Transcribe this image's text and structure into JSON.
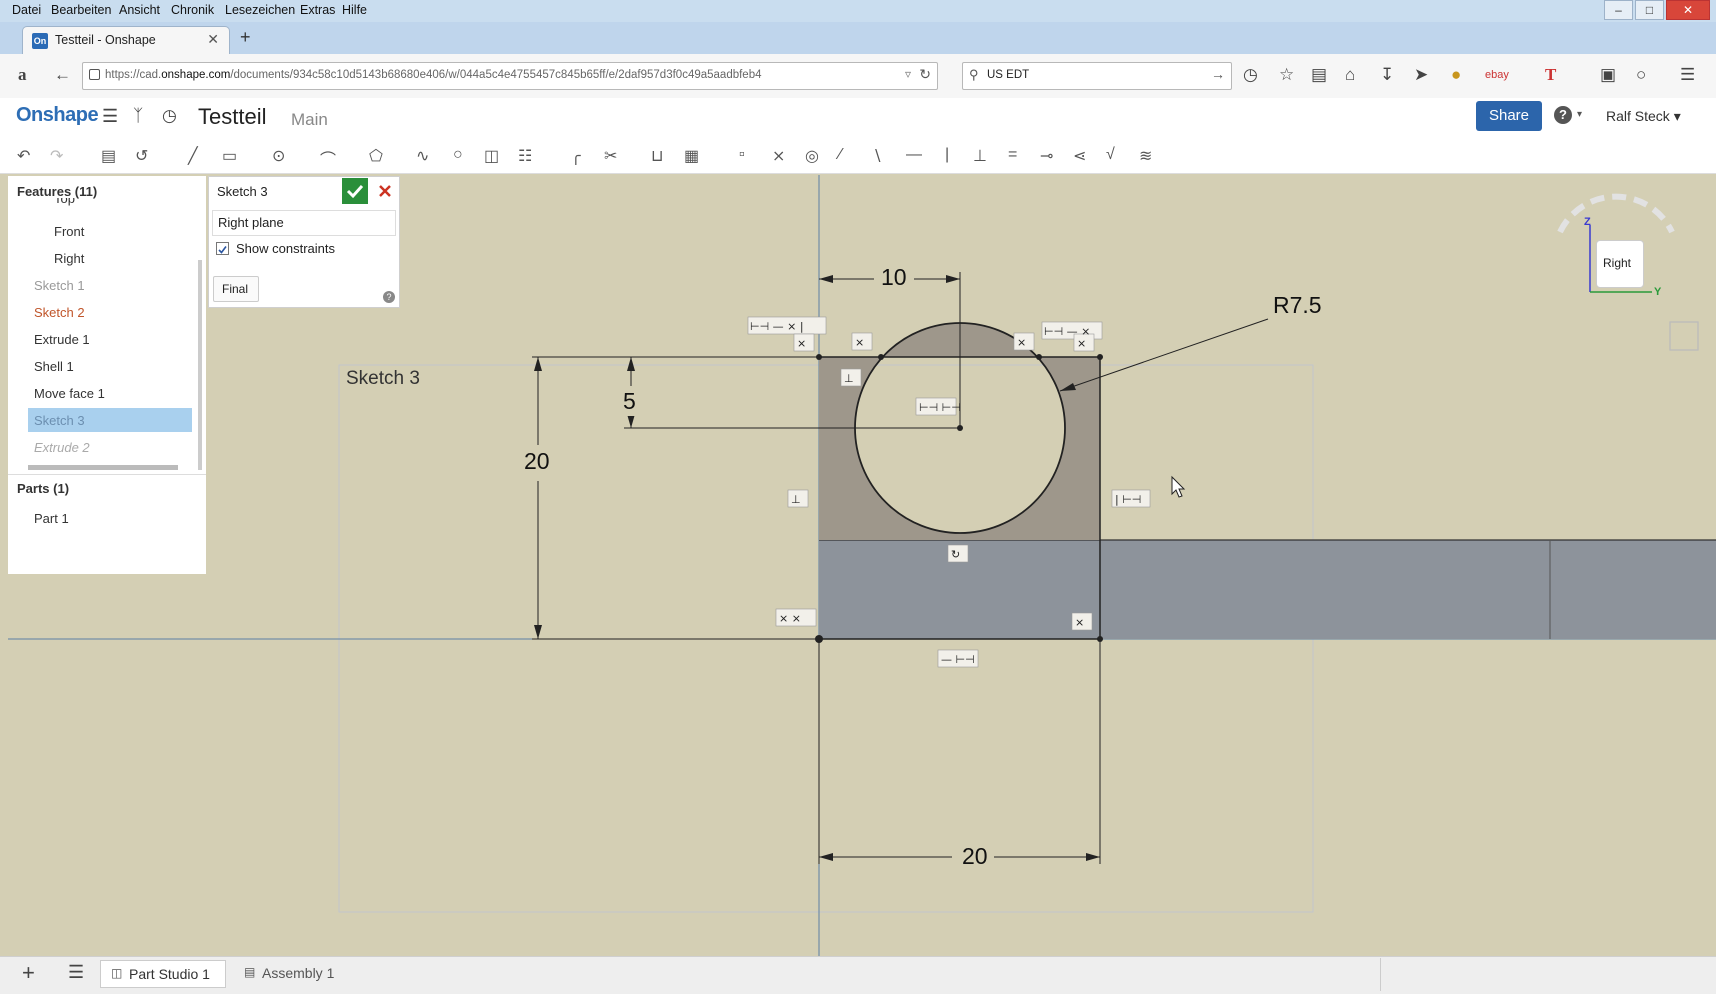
{
  "browser": {
    "menu": [
      "Datei",
      "Bearbeiten",
      "Ansicht",
      "Chronik",
      "Lesezeichen",
      "Extras",
      "Hilfe"
    ],
    "tab_title": "Testteil - Onshape",
    "tab_favicon": "On",
    "url_prefix": "https://cad.",
    "url_host": "onshape.com",
    "url_path": "/documents/934c58c10d5143b68680e406/w/044a5c4e4755457c845b65ff/e/2daf957d3f0c49a5aadbfeb4",
    "search_value": "US EDT"
  },
  "header": {
    "logo": "Onshape",
    "doc_title": "Testteil",
    "workspace": "Main",
    "share_label": "Share",
    "help_label": "?",
    "user_name": "Ralf Steck ▾"
  },
  "features": {
    "title": "Features (11)",
    "items": [
      {
        "label": "Top",
        "style": "plain"
      },
      {
        "label": "Front",
        "style": "plain"
      },
      {
        "label": "Right",
        "style": "plain"
      },
      {
        "label": "Sketch 1",
        "style": "gray"
      },
      {
        "label": "Sketch 2",
        "style": "red"
      },
      {
        "label": "Extrude 1",
        "style": "plain"
      },
      {
        "label": "Shell 1",
        "style": "plain"
      },
      {
        "label": "Move face 1",
        "style": "plain"
      },
      {
        "label": "Sketch 3",
        "style": "selected"
      },
      {
        "label": "Extrude 2",
        "style": "dim"
      }
    ],
    "parts_title": "Parts (1)",
    "parts": [
      "Part 1"
    ]
  },
  "sketch_dialog": {
    "title": "Sketch 3",
    "plane": "Right plane",
    "show_constraints_label": "Show constraints",
    "show_constraints": true,
    "final_label": "Final",
    "help": "?"
  },
  "canvas": {
    "sketch_label": "Sketch 3",
    "dim_top": "10",
    "dim_left_height": "20",
    "dim_offset": "5",
    "dim_radius": "R7.5",
    "dim_bottom": "20"
  },
  "viewcube": {
    "face": "Right",
    "axis_z": "Z",
    "axis_y": "Y"
  },
  "bottom": {
    "tabs": [
      "Part Studio 1",
      "Assembly 1"
    ]
  },
  "colors": {
    "canvas_bg": "#d4cfb4",
    "part_face": "#8d939b",
    "sketch_region": "#9e978b",
    "accent": "#2c65ab",
    "confirm": "#2a8f3a",
    "cancel": "#cc3322"
  }
}
